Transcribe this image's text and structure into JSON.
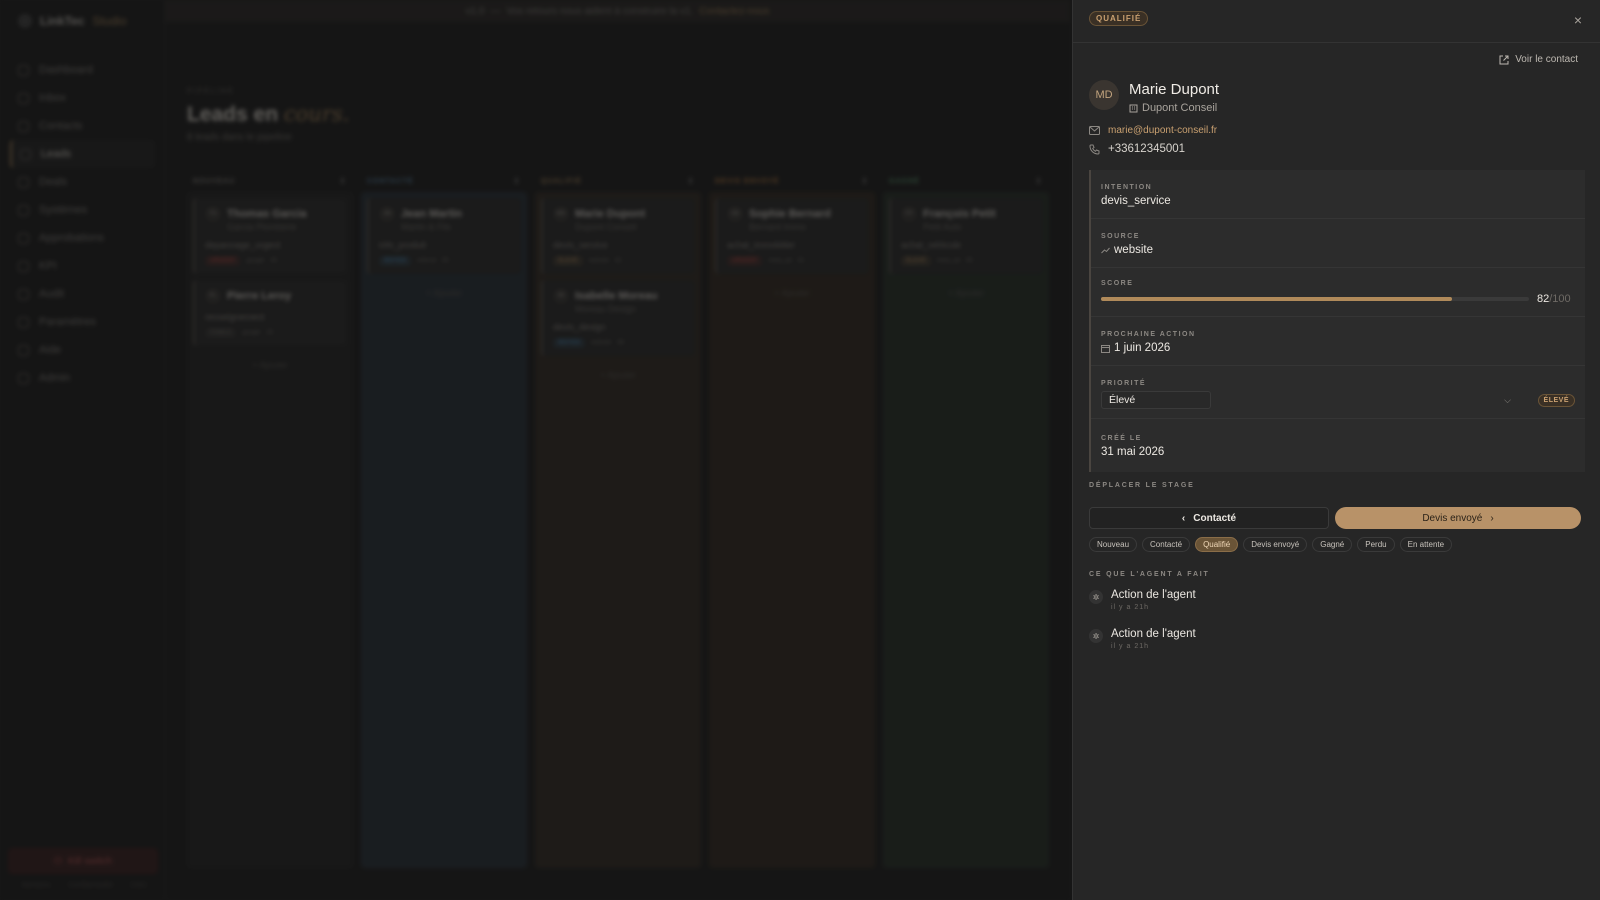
{
  "app": {
    "brand": "LinkTec",
    "brand_accent": "Studio",
    "banner_prefix": "v1.0",
    "banner_text": "Vos retours nous aident à construire la v1.",
    "banner_link": "Contactez-nous",
    "nav": [
      {
        "label": "Dashboard",
        "icon": "grid-icon"
      },
      {
        "label": "Inbox",
        "icon": "inbox-icon"
      },
      {
        "label": "Contacts",
        "icon": "user-icon"
      },
      {
        "label": "Leads",
        "icon": "target-icon",
        "active": true
      },
      {
        "label": "Deals",
        "icon": "handshake-icon"
      },
      {
        "label": "Systèmes",
        "icon": "spark-icon"
      },
      {
        "label": "Approbations",
        "icon": "check-circle-icon"
      },
      {
        "label": "KPI",
        "icon": "bar-chart-icon"
      },
      {
        "label": "Audit",
        "icon": "list-icon"
      },
      {
        "label": "Paramètres",
        "icon": "gear-icon"
      },
      {
        "label": "Aide",
        "icon": "help-icon"
      },
      {
        "label": "Admin",
        "icon": "shield-icon"
      }
    ],
    "kill_switch": "Kill switch",
    "footer": [
      "Mentions",
      "Confidentialité",
      "CGU"
    ]
  },
  "pipeline": {
    "eyebrow": "PIPELINE",
    "title": "Leads en",
    "title_accent": "cours.",
    "subtitle": "8 leads dans le pipeline",
    "add_label": "+ Ajouter",
    "columns": [
      {
        "name": "NOUVEAU",
        "color": "#8c8883",
        "bg": "#232323",
        "cards": [
          {
            "name": "Thomas Garcia",
            "initials": "TG",
            "company": "Garcia Plomberie",
            "intent": "depannage_urgent",
            "tag": "URGENT",
            "tag_color": "#c0453f",
            "source": "google",
            "score": "45"
          },
          {
            "name": "Pierre Leroy",
            "initials": "PL",
            "company": "",
            "intent": "renseignement",
            "tag": "FAIBLE",
            "tag_color": "#6e6a65",
            "source": "google",
            "score": "25"
          }
        ]
      },
      {
        "name": "CONTACTÉ",
        "color": "#5a8ab0",
        "bg": "#27313a",
        "cards": [
          {
            "name": "Jean Martin",
            "initials": "JM",
            "company": "Martin & Fils",
            "intent": "info_produit",
            "tag": "MOYEN",
            "tag_color": "#4a8ab8",
            "source": "referral",
            "score": "55"
          }
        ]
      },
      {
        "name": "QUALIFIÉ",
        "color": "#b08a5a",
        "bg": "#332b23",
        "cards": [
          {
            "name": "Marie Dupont",
            "initials": "MD",
            "company": "Dupont Conseil",
            "intent": "devis_service",
            "tag": "ÉLEVÉ",
            "tag_color": "#b08a5a",
            "source": "website",
            "score": "82"
          },
          {
            "name": "Isabelle Moreau",
            "initials": "IM",
            "company": "Moreau Design",
            "intent": "devis_design",
            "tag": "MOYEN",
            "tag_color": "#4a8ab8",
            "source": "website",
            "score": "68"
          }
        ]
      },
      {
        "name": "DEVIS ENVOYÉ",
        "color": "#c9823e",
        "bg": "#33291f",
        "cards": [
          {
            "name": "Sophie Bernard",
            "initials": "SB",
            "company": "Bernard Immo",
            "intent": "achat_immobilier",
            "tag": "URGENT",
            "tag_color": "#c0453f",
            "source": "meta_ad",
            "score": "91"
          }
        ]
      },
      {
        "name": "GAGNÉ",
        "color": "#5aa070",
        "bg": "#263128",
        "cards": [
          {
            "name": "François Petit",
            "initials": "FP",
            "company": "Petit Auto",
            "intent": "achat_vehicule",
            "tag": "ÉLEVÉ",
            "tag_color": "#b08a5a",
            "source": "meta_ad",
            "score": "95"
          }
        ]
      }
    ]
  },
  "drawer": {
    "stage_badge": "QUALIFIÉ",
    "close": "×",
    "view_contact": "Voir le contact",
    "contact": {
      "initials": "MD",
      "name": "Marie Dupont",
      "company": "Dupont Conseil",
      "email": "marie@dupont-conseil.fr",
      "phone": "+33612345001"
    },
    "intention_label": "INTENTION",
    "intention": "devis_service",
    "source_label": "SOURCE",
    "source": "website",
    "score_label": "SCORE",
    "score": 82,
    "score_display": "82",
    "score_max": "/100",
    "next_action_label": "PROCHAINE ACTION",
    "next_action": "1 juin 2026",
    "priority_label": "PRIORITÉ",
    "priority_value": "Élevé",
    "priority_badge": "ÉLEVÉ",
    "created_label": "CRÉÉ LE",
    "created": "31 mai 2026",
    "move_stage_label": "DÉPLACER LE STAGE",
    "prev_stage": "Contacté",
    "next_stage": "Devis envoyé",
    "stages": [
      "Nouveau",
      "Contacté",
      "Qualifié",
      "Devis envoyé",
      "Gagné",
      "Perdu",
      "En attente"
    ],
    "active_stage": "Qualifié",
    "agent_label": "CE QUE L'AGENT A FAIT",
    "agent_actions": [
      {
        "title": "Action de l'agent",
        "time": "il y a 21h"
      },
      {
        "title": "Action de l'agent",
        "time": "il y a 21h"
      }
    ],
    "colors": {
      "accent": "#b08a5a",
      "badge_text": "#c9a070",
      "next_button": "#b89268"
    }
  }
}
